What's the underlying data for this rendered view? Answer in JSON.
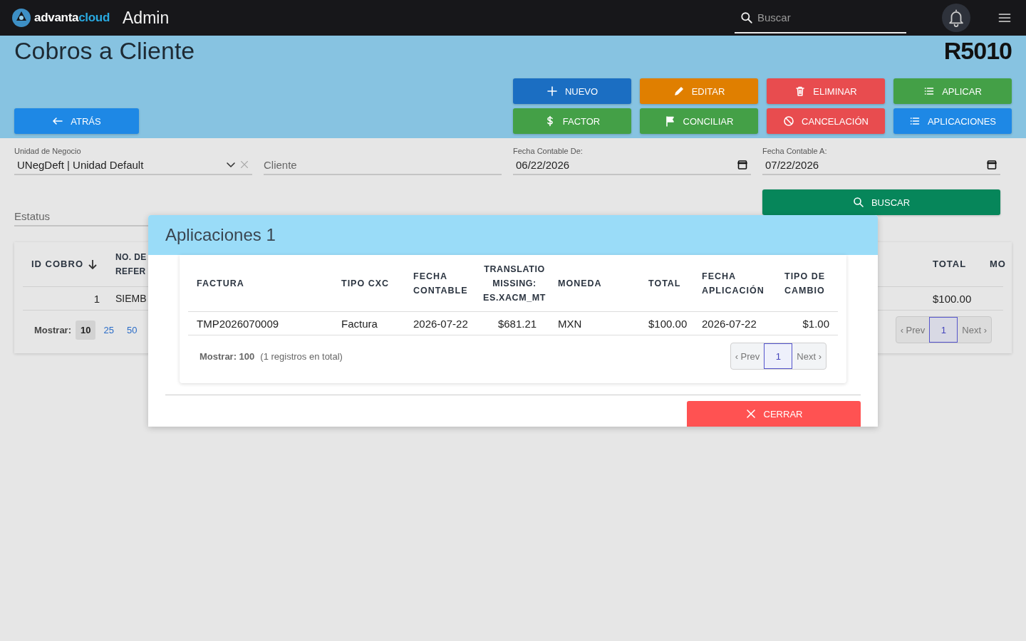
{
  "app": {
    "brand": "advanta",
    "brand_suffix": "cloud",
    "title": "Admin"
  },
  "search": {
    "placeholder": "Buscar"
  },
  "page": {
    "title": "Cobros a Cliente",
    "code": "R5010"
  },
  "back_button": "ATRÁS",
  "action_buttons": [
    {
      "label": "NUEVO",
      "color": "#1b6ec2"
    },
    {
      "label": "EDITAR",
      "color": "#e07f00"
    },
    {
      "label": "ELIMINAR",
      "color": "#e84c4f"
    },
    {
      "label": "APLICAR",
      "color": "#44a047"
    },
    {
      "label": "FACTOR",
      "color": "#44a047"
    },
    {
      "label": "CONCILIAR",
      "color": "#44a047"
    },
    {
      "label": "CANCELACIÓN",
      "color": "#e84c4f"
    },
    {
      "label": "APLICACIONES",
      "color": "#1e88e5"
    }
  ],
  "filters": [
    {
      "kind": "select",
      "label": "Unidad de Negocio",
      "value": "UNegDeft | Unidad Default"
    },
    {
      "kind": "text",
      "placeholder": "Cliente"
    },
    {
      "kind": "date",
      "label": "Fecha Contable De:",
      "value": "06/22/2026"
    },
    {
      "kind": "date",
      "label": "Fecha Contable A:",
      "value": "07/22/2026"
    },
    {
      "kind": "text",
      "placeholder": "Estatus"
    }
  ],
  "search_button": "BUSCAR",
  "table": {
    "columns": [
      {
        "label": "ID COBRO",
        "sorted": true
      },
      {
        "label": "NO. DE REFER",
        "sorted": false
      },
      {
        "label": "TOTAL",
        "sorted": false
      },
      {
        "label": "MO",
        "sorted": false
      }
    ],
    "rows": [
      {
        "cells": [
          "1",
          "SIEMB",
          "$100.00"
        ]
      }
    ],
    "page_size_label": "Mostrar:",
    "page_sizes": [
      {
        "label": "10",
        "selected": true
      },
      {
        "label": "25",
        "selected": false
      },
      {
        "label": "50",
        "selected": false
      }
    ],
    "pagination": {
      "prev": "‹ Prev",
      "pages": [
        {
          "label": "1",
          "selected": true
        }
      ],
      "next": "Next ›"
    }
  },
  "modal": {
    "title": "Aplicaciones 1",
    "columns": [
      "FACTURA",
      "TIPO CXC",
      "FECHA CONTABLE",
      "TRANSLATIO MISSING: ES.XACM_MT",
      "MONEDA",
      "TOTAL",
      "FECHA APLICACIÓN",
      "TIPO DE CAMBIO"
    ],
    "rows": [
      [
        "TMP2026070009",
        "Factura",
        "2026-07-22",
        "$681.21",
        "MXN",
        "$100.00",
        "2026-07-22",
        "$1.00"
      ]
    ],
    "page_size_text": "Mostrar: 100",
    "total_text": "(1 registros en total)",
    "pagination": {
      "prev": "‹ Prev",
      "pages": [
        {
          "label": "1",
          "selected": true
        }
      ],
      "next": "Next ›"
    },
    "close_button": "CERRAR"
  }
}
